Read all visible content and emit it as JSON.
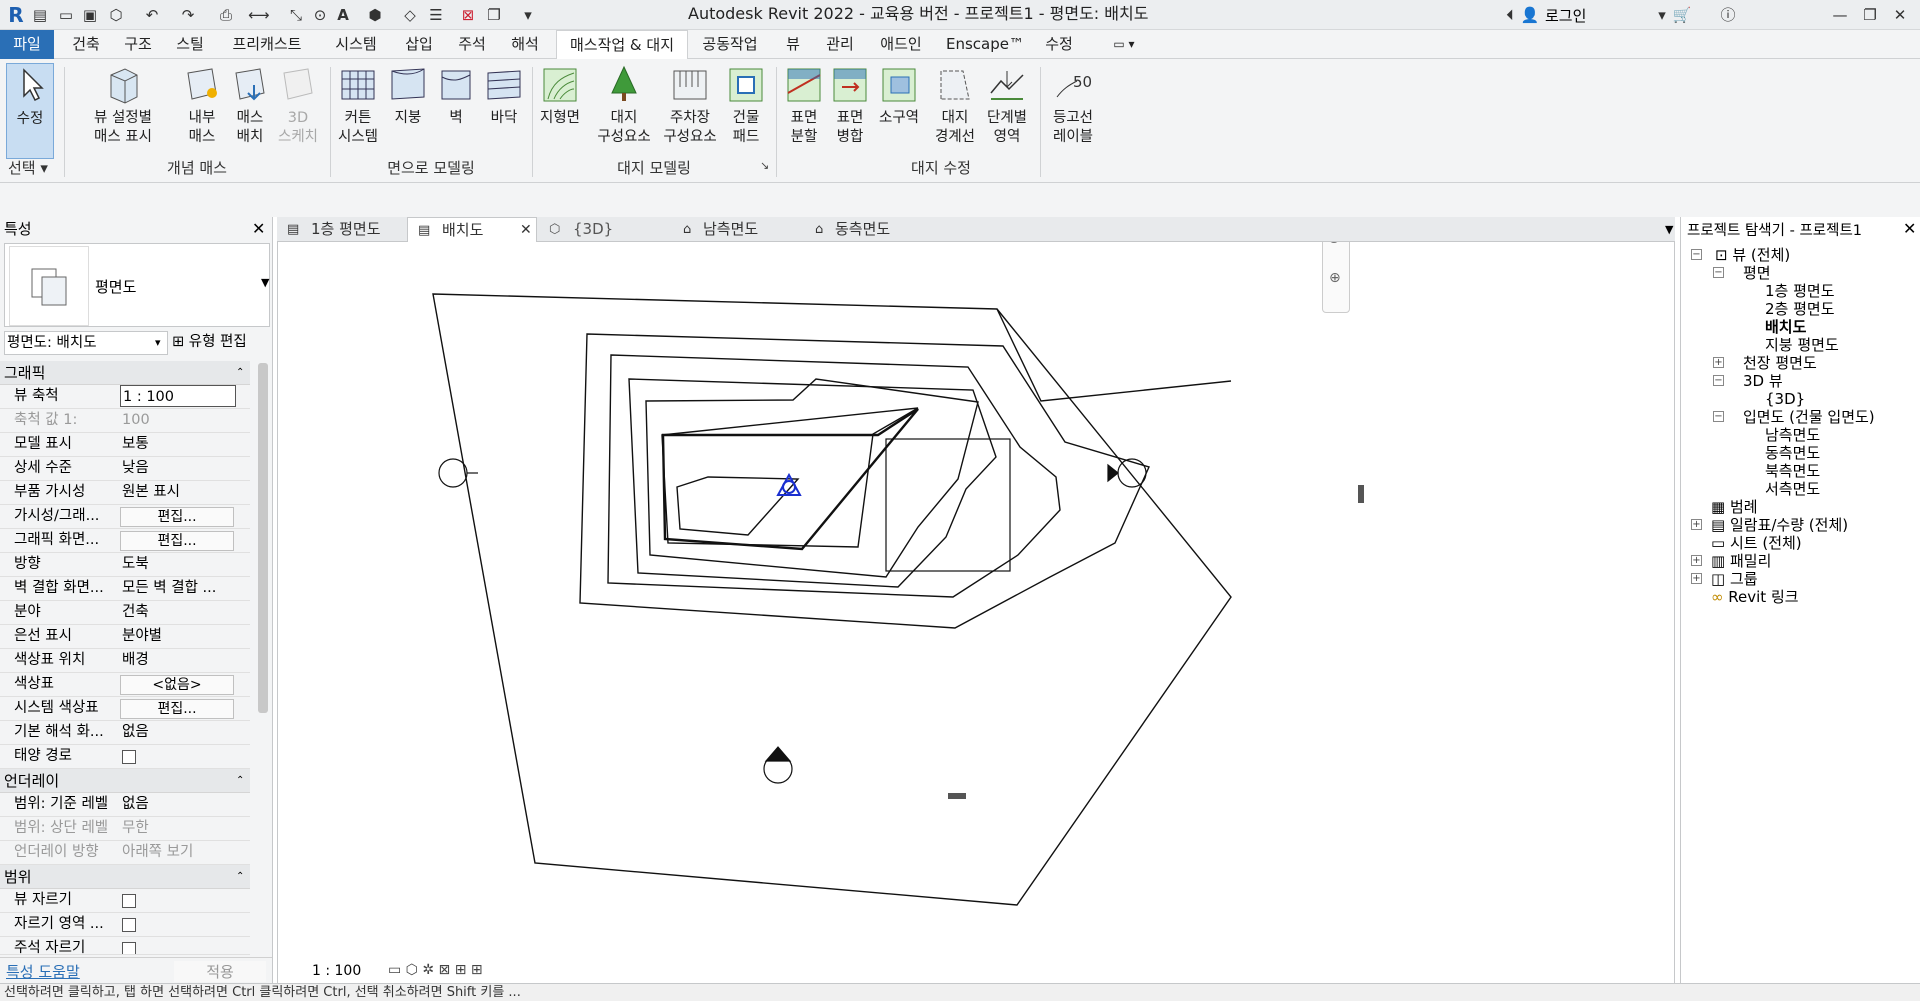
{
  "titlebar": {
    "title": "Autodesk Revit 2022 - 교육용 버전 - 프로젝트1 - 평면도: 배치도",
    "login": "로그인"
  },
  "menu_tabs": [
    "파일",
    "건축",
    "구조",
    "스틸",
    "프리캐스트",
    "시스템",
    "삽입",
    "주석",
    "해석",
    "매스작업 & 대지",
    "공동작업",
    "뷰",
    "관리",
    "애드인",
    "Enscape™",
    "수정"
  ],
  "ribbon": {
    "buttons": [
      {
        "label1": "수정",
        "label2": ""
      },
      {
        "label1": "뷰 설정별",
        "label2": "매스 표시"
      },
      {
        "label1": "내부",
        "label2": "매스"
      },
      {
        "label1": "매스",
        "label2": "배치"
      },
      {
        "label1": "3D",
        "label2": "스케치"
      },
      {
        "label1": "커튼",
        "label2": "시스템"
      },
      {
        "label1": "지붕",
        "label2": ""
      },
      {
        "label1": "벽",
        "label2": ""
      },
      {
        "label1": "바닥",
        "label2": ""
      },
      {
        "label1": "지형면",
        "label2": ""
      },
      {
        "label1": "대지",
        "label2": "구성요소"
      },
      {
        "label1": "주차장",
        "label2": "구성요소"
      },
      {
        "label1": "건물",
        "label2": "패드"
      },
      {
        "label1": "표면",
        "label2": "분할"
      },
      {
        "label1": "표면",
        "label2": "병합"
      },
      {
        "label1": "소구역",
        "label2": ""
      },
      {
        "label1": "대지",
        "label2": "경계선"
      },
      {
        "label1": "단계별",
        "label2": "영역"
      },
      {
        "label1": "등고선",
        "label2": "레이블"
      }
    ],
    "groups": [
      "선택",
      "개념 매스",
      "면으로 모델링",
      "대지 모델링",
      "대지 수정"
    ]
  },
  "properties": {
    "panel_title": "특성",
    "type_name": "평면도",
    "selector": "평면도: 배치도",
    "edit_type": "유형 편집",
    "sections": {
      "graphics": "그래픽",
      "underlay": "언더레이",
      "extents": "범위"
    },
    "rows": [
      {
        "k": "뷰 축척",
        "v": "1 : 100"
      },
      {
        "k": "축척 값    1:",
        "v": "100"
      },
      {
        "k": "모델 표시",
        "v": "보통"
      },
      {
        "k": "상세 수준",
        "v": "낮음"
      },
      {
        "k": "부품 가시성",
        "v": "원본 표시"
      },
      {
        "k": "가시성/그래...",
        "v": "편집..."
      },
      {
        "k": "그래픽 화면...",
        "v": "편집..."
      },
      {
        "k": "방향",
        "v": "도북"
      },
      {
        "k": "벽 결합 화면...",
        "v": "모든 벽 결합 ..."
      },
      {
        "k": "분야",
        "v": "건축"
      },
      {
        "k": "은선 표시",
        "v": "분야별"
      },
      {
        "k": "색상표 위치",
        "v": "배경"
      },
      {
        "k": "색상표",
        "v": "<없음>"
      },
      {
        "k": "시스템 색상표",
        "v": "편집..."
      },
      {
        "k": "기본 해석 화...",
        "v": "없음"
      },
      {
        "k": "태양 경로",
        "v": ""
      },
      {
        "k": "범위: 기준 레벨",
        "v": "없음"
      },
      {
        "k": "범위: 상단 레벨",
        "v": "무한"
      },
      {
        "k": "언더레이 방향",
        "v": "아래쪽 보기"
      },
      {
        "k": "뷰 자르기",
        "v": ""
      },
      {
        "k": "자르기 영역 ...",
        "v": ""
      },
      {
        "k": "주석 자르기",
        "v": ""
      }
    ],
    "help_link": "특성 도움말",
    "apply": "적용"
  },
  "view_tabs": [
    "1층 평면도",
    "배치도",
    "{3D}",
    "남측면도",
    "동측면도"
  ],
  "view_scale": "1 : 100",
  "browser": {
    "title": "프로젝트 탐색기 - 프로젝트1",
    "items": [
      "뷰 (전체)",
      "평면",
      "1층 평면도",
      "2층 평면도",
      "배치도",
      "지붕 평면도",
      "천장 평면도",
      "3D 뷰",
      "{3D}",
      "입면도 (건물 입면도)",
      "남측면도",
      "동측면도",
      "북측면도",
      "서측면도",
      "범례",
      "일람표/수량 (전체)",
      "시트 (전체)",
      "패밀리",
      "그룹",
      "Revit 링크"
    ]
  },
  "status_text": "선택하려면 클릭하고, 탭 하면 선택하려면 Ctrl 클릭하려면 Ctrl, 선택 취소하려면 Shift 키를 ...",
  "colors": {
    "accent": "#2a6fb6",
    "canvas": "#ffffff",
    "survey_point": "#1a2fd0"
  }
}
